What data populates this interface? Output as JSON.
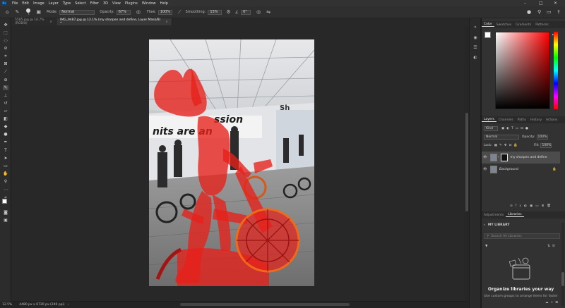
{
  "menu": {
    "app_badge": "Ps",
    "items": [
      "File",
      "Edit",
      "Image",
      "Layer",
      "Type",
      "Select",
      "Filter",
      "3D",
      "View",
      "Plugins",
      "Window",
      "Help"
    ],
    "window_controls": [
      "–",
      "□",
      "✕"
    ]
  },
  "options": {
    "brush_size": "3",
    "mode_label": "Mode:",
    "mode_value": "Normal",
    "opacity_label": "Opacity:",
    "opacity_value": "67%",
    "flow_label": "Flow:",
    "flow_value": "100%",
    "smoothing_label": "Smoothing:",
    "smoothing_value": "15%",
    "angle_value": "0°"
  },
  "tabs": [
    {
      "label": "5585.jpg @ 16.7% (RGB/8)",
      "close": "×"
    },
    {
      "label": "IMG_9487.jpg @ 12.1% (my sharpen and define, Layer Mask/8) *",
      "close": "×"
    }
  ],
  "status": {
    "zoom": "12.5%",
    "doc_info": "4480 px x 6720 px (240 ppi)"
  },
  "color_panel": {
    "tabs": [
      "Color",
      "Swatches",
      "Gradients",
      "Patterns"
    ],
    "hue_base": "#ff0000"
  },
  "layers_panel": {
    "tabs": [
      "Layers",
      "Channels",
      "Paths",
      "History",
      "Actions"
    ],
    "kind_label": "Kind",
    "blend_mode": "Normal",
    "opacity_label": "Opacity:",
    "opacity_value": "100%",
    "lock_label": "Lock:",
    "fill_label": "Fill:",
    "fill_value": "100%",
    "layers": [
      {
        "name": "my sharpen and define",
        "selected": true
      },
      {
        "name": "Background",
        "selected": false
      }
    ]
  },
  "libraries_panel": {
    "tabs": [
      "Adjustments",
      "Libraries"
    ],
    "library_name": "MY LIBRARY",
    "search_placeholder": "Search All Libraries",
    "heading": "Organize libraries your way",
    "desc": "Use custom groups to arrange items for faster"
  },
  "colors": {
    "accent": "#31a8ff",
    "overlay": "#e8201a"
  }
}
